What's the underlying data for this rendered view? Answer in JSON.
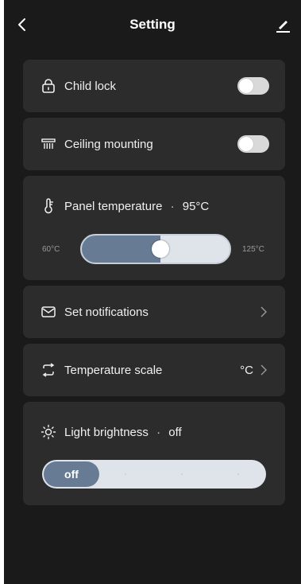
{
  "header": {
    "title": "Setting",
    "back_icon": "chevron-left-icon",
    "edit_icon": "pencil-icon"
  },
  "child_lock": {
    "label": "Child lock",
    "icon": "lock-icon",
    "enabled": false
  },
  "ceiling_mounting": {
    "label": "Ceiling mounting",
    "icon": "heater-icon",
    "enabled": false
  },
  "panel_temperature": {
    "label": "Panel temperature",
    "separator": "·",
    "value_text": "95°C",
    "icon": "thermometer-icon",
    "min_label": "60°C",
    "max_label": "125°C",
    "min": 60,
    "max": 125,
    "value": 95
  },
  "notifications": {
    "label": "Set notifications",
    "icon": "mail-icon"
  },
  "temperature_scale": {
    "label": "Temperature scale",
    "icon": "swap-icon",
    "value": "°C"
  },
  "light_brightness": {
    "label": "Light brightness",
    "separator": "·",
    "value_text": "off",
    "icon": "sun-icon",
    "selected_label": "off",
    "level": 0
  },
  "colors": {
    "background": "#1a1a1a",
    "card": "#2c2c2c",
    "accent": "#677c94",
    "track": "#dfe3ea"
  }
}
